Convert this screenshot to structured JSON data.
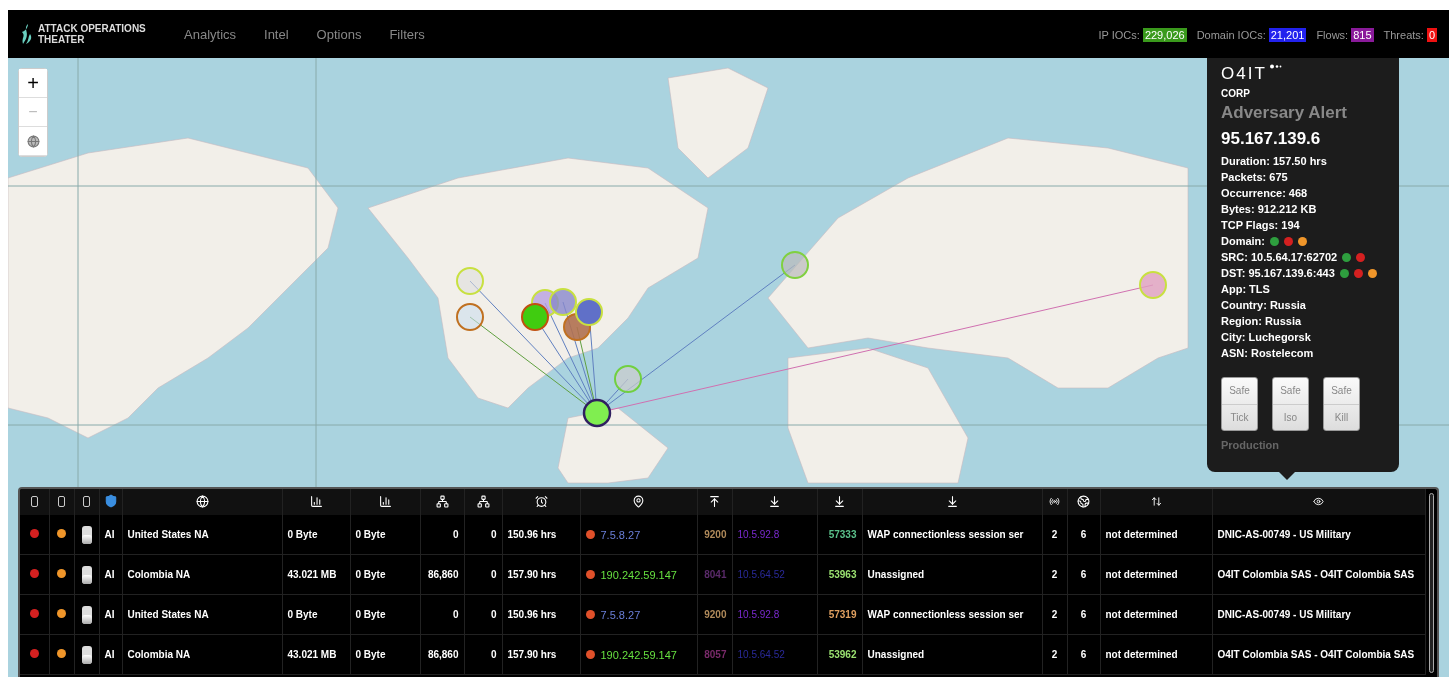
{
  "header": {
    "brand": "ATTACK OPERATIONS THEATER",
    "nav": [
      "Analytics",
      "Intel",
      "Options",
      "Filters"
    ],
    "stats": [
      {
        "label": "IP IOCs:",
        "value": "229,026",
        "color": "#3a9a1c"
      },
      {
        "label": "Domain IOCs:",
        "value": "21,201",
        "color": "#2222ee"
      },
      {
        "label": "Flows:",
        "value": "815",
        "color": "#8a1a9a"
      },
      {
        "label": "Threats:",
        "value": "0",
        "color": "#ee1111"
      }
    ]
  },
  "map_controls": {
    "zoom_in": "+",
    "zoom_out": "−"
  },
  "alert": {
    "logo": "O4IT",
    "org": "CORP",
    "title": "Adversary Alert",
    "ip": "95.167.139.6",
    "fields": [
      {
        "text": "Duration: 157.50 hrs"
      },
      {
        "text": "Packets: 675"
      },
      {
        "text": "Occurrence: 468"
      },
      {
        "text": "Bytes: 912.212 KB"
      },
      {
        "text": "TCP Flags: 194"
      },
      {
        "text": "Domain:",
        "dots": [
          {
            "color": "#2e9e3e"
          },
          {
            "color": "#d42020"
          },
          {
            "color": "#f0962a"
          }
        ]
      },
      {
        "text": "SRC: 10.5.64.17:62702",
        "dots": [
          {
            "color": "#2e9e3e"
          },
          {
            "color": "#d42020"
          }
        ]
      },
      {
        "text": "DST: 95.167.139.6:443",
        "dots": [
          {
            "color": "#2e9e3e"
          },
          {
            "color": "#d42020"
          },
          {
            "color": "#f0962a"
          }
        ]
      },
      {
        "text": "App: TLS"
      },
      {
        "text": "Country: Russia"
      },
      {
        "text": "Region: Russia"
      },
      {
        "text": "City: Luchegorsk"
      },
      {
        "text": "ASN: Rostelecom"
      }
    ],
    "buttons": [
      {
        "top": "Safe",
        "bottom": "Tick"
      },
      {
        "top": "Safe",
        "bottom": "Iso"
      },
      {
        "top": "Safe",
        "bottom": "Kill"
      }
    ],
    "footer": "Production"
  },
  "table": {
    "rows": [
      {
        "dots": [
          {
            "color": "#d42020"
          },
          {
            "color": "#f0962a"
          }
        ],
        "toggle_on": true,
        "ai": "AI",
        "country": "United States  NA",
        "bytes_in": "0 Byte",
        "bytes_out": "0 Byte",
        "packets_in": "0",
        "packets_out": "0",
        "duration": "150.96 hrs",
        "src_marker": {
          "color": "#e0502a"
        },
        "src_ip": {
          "text": "7.5.8.27",
          "color": "#6a7fd8"
        },
        "src_port": {
          "text": "9200",
          "color": "#b08a5a"
        },
        "dst_ip": {
          "text": "10.5.92.8",
          "color": "#7a2ad0"
        },
        "dst_port": {
          "text": "57333",
          "color": "#5ac08a"
        },
        "service": "WAP connectionless session ser",
        "column_17": "2",
        "column_18": "6",
        "direction": "not determined",
        "asn": "DNIC-AS-00749 - US Military"
      },
      {
        "dots": [
          {
            "color": "#d42020"
          },
          {
            "color": "#f0962a"
          }
        ],
        "toggle_on": true,
        "ai": "AI",
        "country": "Colombia  NA",
        "bytes_in": "43.021 MB",
        "bytes_out": "0 Byte",
        "packets_in": "86,860",
        "packets_out": "0",
        "duration": "157.90 hrs",
        "src_marker": {
          "color": "#e0502a"
        },
        "src_ip": {
          "text": "190.242.59.147",
          "color": "#66e040"
        },
        "src_port": {
          "text": "8041",
          "color": "#5a2a6a"
        },
        "dst_ip": {
          "text": "10.5.64.52",
          "color": "#2a2a9a"
        },
        "dst_port": {
          "text": "53963",
          "color": "#9ae070"
        },
        "service": "Unassigned",
        "column_17": "2",
        "column_18": "6",
        "direction": "not determined",
        "asn": "O4IT Colombia SAS - O4IT Colombia SAS"
      },
      {
        "dots": [
          {
            "color": "#d42020"
          },
          {
            "color": "#f0962a"
          }
        ],
        "toggle_on": true,
        "ai": "AI",
        "country": "United States  NA",
        "bytes_in": "0 Byte",
        "bytes_out": "0 Byte",
        "packets_in": "0",
        "packets_out": "0",
        "duration": "150.96 hrs",
        "src_marker": {
          "color": "#e0502a"
        },
        "src_ip": {
          "text": "7.5.8.27",
          "color": "#6a7fd8"
        },
        "src_port": {
          "text": "9200",
          "color": "#b08a5a"
        },
        "dst_ip": {
          "text": "10.5.92.8",
          "color": "#7a2ad0"
        },
        "dst_port": {
          "text": "57319",
          "color": "#e0a060"
        },
        "service": "WAP connectionless session ser",
        "column_17": "2",
        "column_18": "6",
        "direction": "not determined",
        "asn": "DNIC-AS-00749 - US Military"
      },
      {
        "dots": [
          {
            "color": "#d42020"
          },
          {
            "color": "#f0962a"
          }
        ],
        "toggle_on": true,
        "ai": "AI",
        "country": "Colombia  NA",
        "bytes_in": "43.021 MB",
        "bytes_out": "0 Byte",
        "packets_in": "86,860",
        "packets_out": "0",
        "duration": "157.90 hrs",
        "src_marker": {
          "color": "#e0502a"
        },
        "src_ip": {
          "text": "190.242.59.147",
          "color": "#66e040"
        },
        "src_port": {
          "text": "8057",
          "color": "#7a2a6a"
        },
        "dst_ip": {
          "text": "10.5.64.52",
          "color": "#2a2a9a"
        },
        "dst_port": {
          "text": "53962",
          "color": "#9ae070"
        },
        "service": "Unassigned",
        "column_17": "2",
        "column_18": "6",
        "direction": "not determined",
        "asn": "O4IT Colombia SAS - O4IT Colombia SAS"
      }
    ]
  }
}
